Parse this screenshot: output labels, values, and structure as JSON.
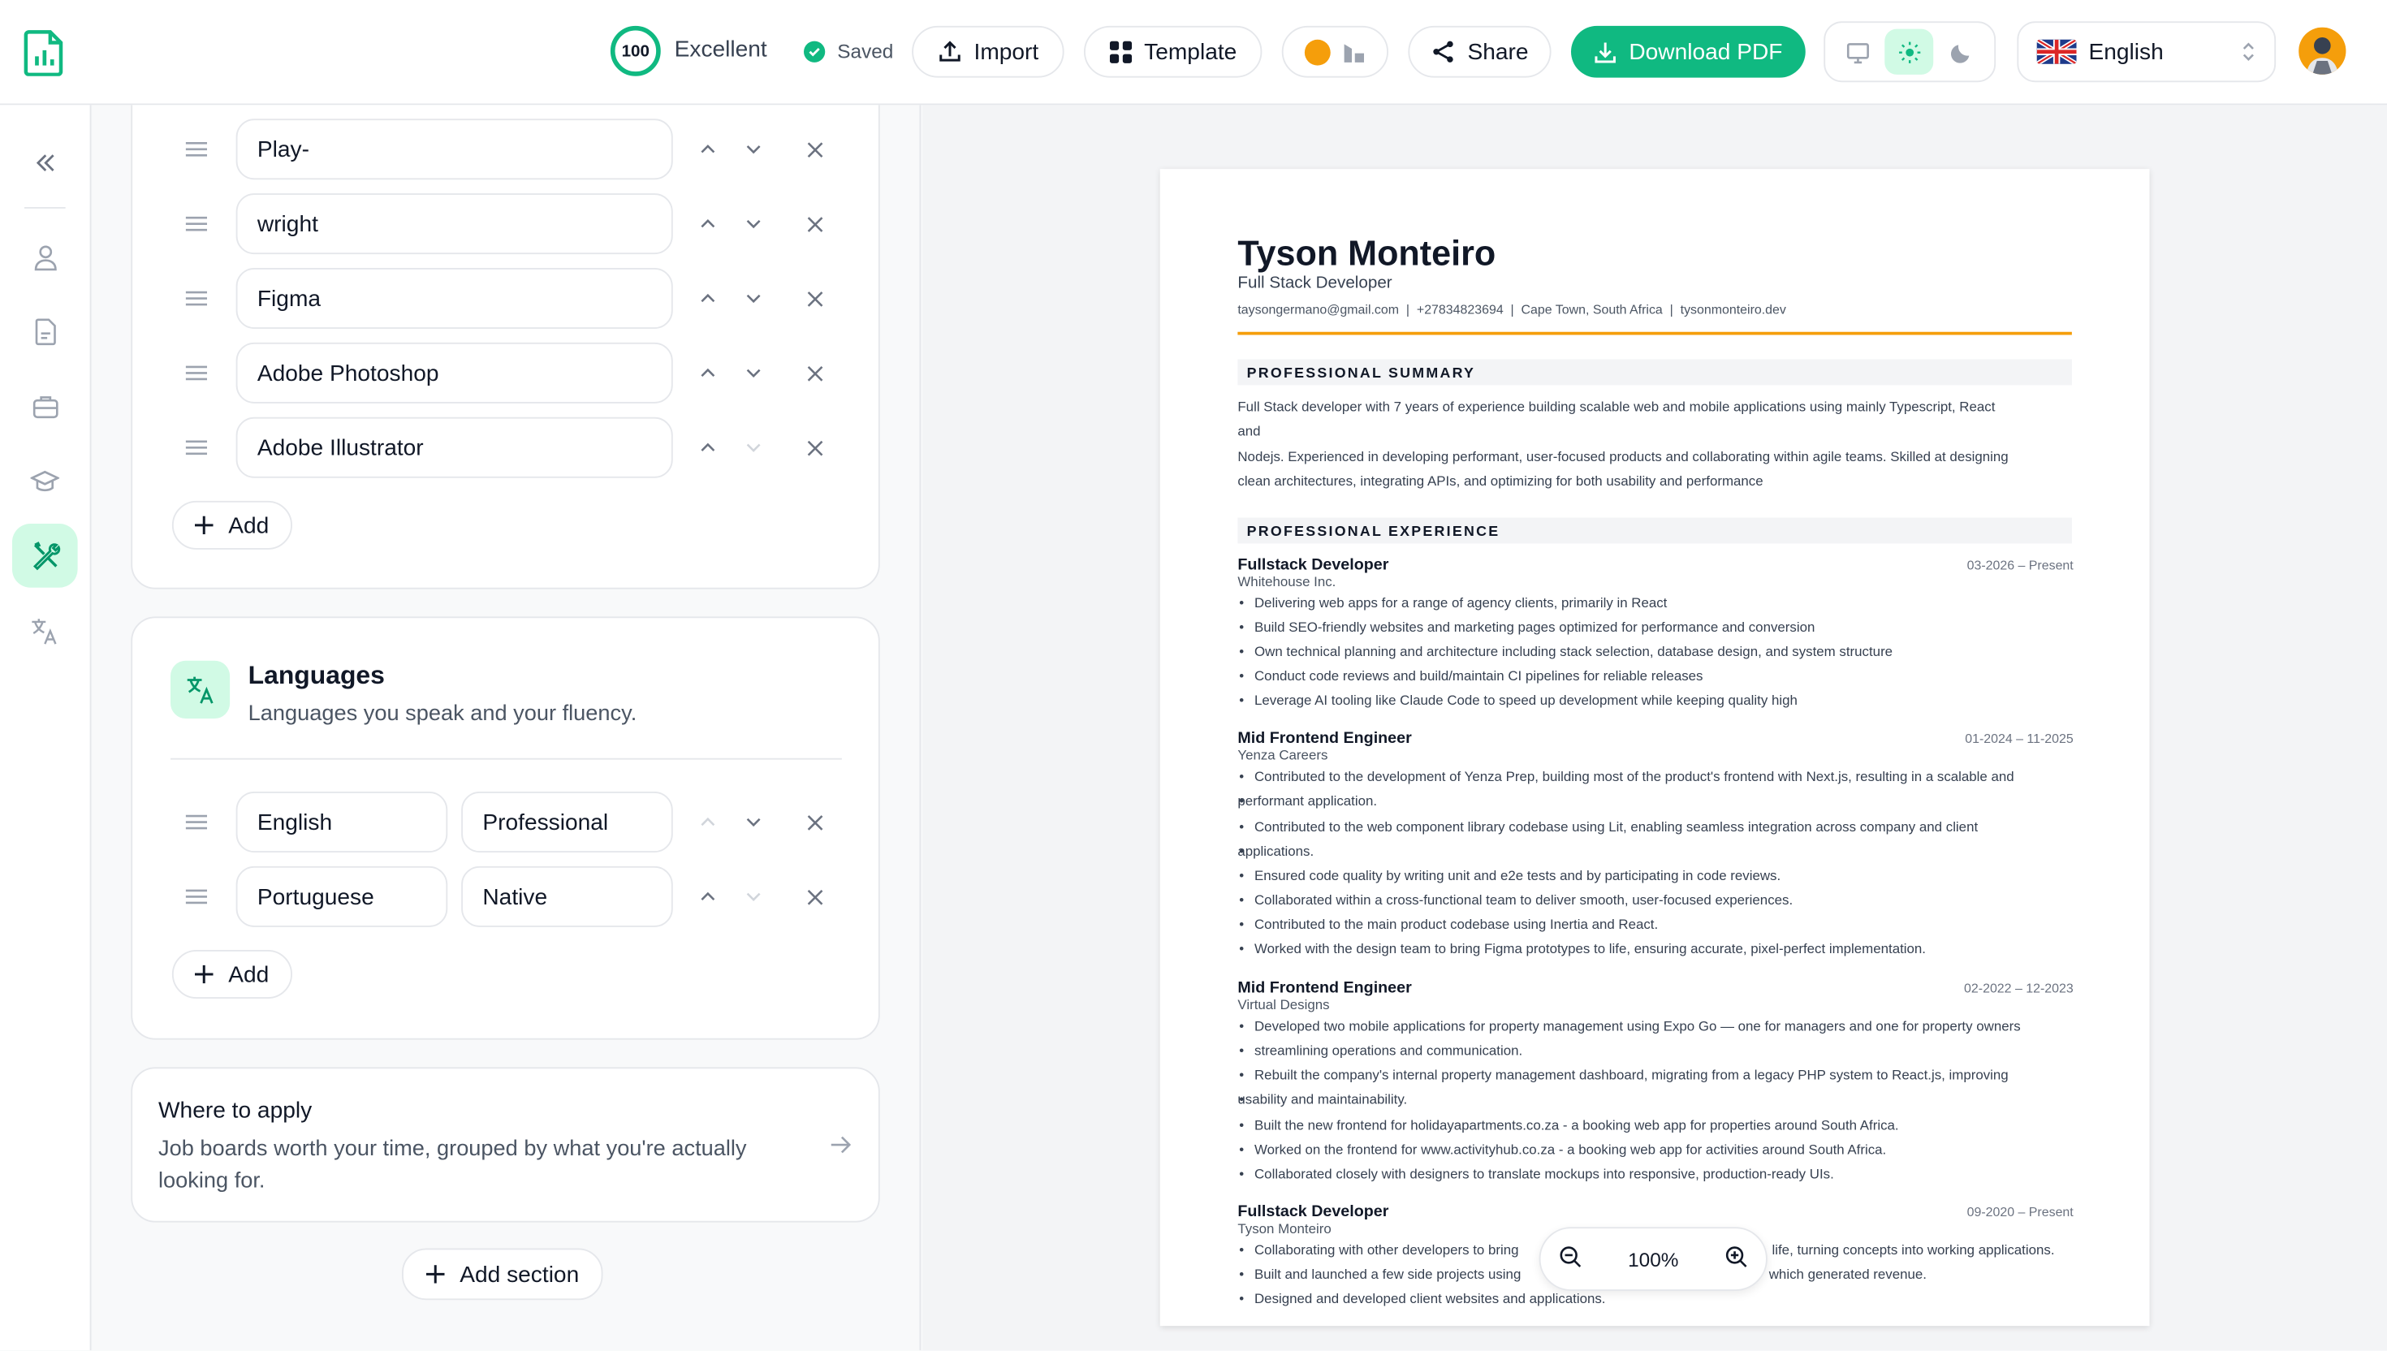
{
  "topbar": {
    "score": "100",
    "score_label": "Excellent",
    "saved_label": "Saved",
    "import_label": "Import",
    "template_label": "Template",
    "share_label": "Share",
    "download_label": "Download PDF",
    "language": "English",
    "accent_color": "#10b981"
  },
  "sidebar": {
    "items": [
      {
        "icon": "collapse-icon"
      },
      {
        "icon": "user-icon"
      },
      {
        "icon": "document-icon"
      },
      {
        "icon": "briefcase-icon"
      },
      {
        "icon": "graduation-cap-icon"
      },
      {
        "icon": "tools-icon",
        "active": true
      },
      {
        "icon": "translate-icon"
      }
    ]
  },
  "skills": {
    "items": [
      "Play-",
      "wright",
      "Figma",
      "Adobe Photoshop",
      "Adobe Illustrator"
    ],
    "add_label": "Add"
  },
  "languages": {
    "title": "Languages",
    "description": "Languages you speak and your fluency.",
    "items": [
      {
        "language": "English",
        "level": "Professional"
      },
      {
        "language": "Portuguese",
        "level": "Native"
      }
    ],
    "add_label": "Add"
  },
  "where_to_apply": {
    "title": "Where to apply",
    "line1": "Job boards worth your time, grouped by what you're actually",
    "line2": "looking for."
  },
  "add_section_label": "Add section",
  "resume": {
    "name": "Tyson Monteiro",
    "role": "Full Stack Developer",
    "contact": "taysongermano@gmail.com  |  +27834823694  |  Cape Town, South Africa  |  tysonmonteiro.dev",
    "summary_heading": "PROFESSIONAL SUMMARY",
    "summary_line1": "Full Stack developer with 7 years of experience building scalable web and mobile applications using mainly Typescript, React",
    "summary_line2": "and",
    "summary_line3": "Nodejs. Experienced in developing performant, user-focused products and collaborating within agile teams. Skilled at designing",
    "summary_line4": "clean architectures, integrating APIs, and optimizing for both usability and performance",
    "experience_heading": "PROFESSIONAL EXPERIENCE",
    "jobs": [
      {
        "title": "Fullstack Developer",
        "company": "Whitehouse Inc.",
        "dates": "03-2026 – Present",
        "bullets": [
          "Delivering web apps for a range of agency clients, primarily in React",
          "Build SEO-friendly websites and marketing pages optimized for performance and conversion",
          "Own technical planning and architecture including stack selection, database design, and system structure",
          "Conduct code reviews and build/maintain CI pipelines for reliable releases",
          "Leverage AI tooling like Claude Code to speed up development while keeping quality high"
        ]
      },
      {
        "title": "Mid Frontend Engineer",
        "company": "Yenza Careers",
        "dates": "01-2024 – 11-2025",
        "bullets": [
          "Contributed to the development of Yenza Prep, building most of the product's frontend with Next.js, resulting in a scalable and",
          "performant application.",
          "Contributed to the web component library codebase using Lit, enabling seamless integration across company and client",
          "applications.",
          "Ensured code quality by writing unit and e2e tests and by participating in code reviews.",
          "Collaborated within a cross-functional team to deliver smooth, user-focused experiences.",
          "Contributed to the main product codebase using Inertia and React.",
          "Worked with the design team to bring Figma prototypes to life, ensuring accurate, pixel-perfect implementation."
        ]
      },
      {
        "title": "Mid Frontend Engineer",
        "company": "Virtual Designs",
        "dates": "02-2022 – 12-2023",
        "bullets": [
          "Developed two mobile applications for property management using Expo Go — one for managers and one for property owners",
          "streamlining operations and communication.",
          "Rebuilt the company's internal property management dashboard, migrating from a legacy PHP system to React.js, improving",
          "usability and maintainability.",
          "Built the new frontend for holidayapartments.co.za - a booking web app for properties around South Africa.",
          "Worked on the frontend for www.activityhub.co.za - a booking web app for activities around South Africa.",
          "Collaborated closely with designers to translate mockups into responsive, production-ready UIs."
        ]
      },
      {
        "title": "Fullstack Developer",
        "company": "Tyson Monteiro",
        "dates": "09-2020 – Present",
        "bullets": [
          "Collaborating with other developers to bring",
          "life, turning concepts into working applications.",
          "Built and launched a few side projects using",
          "which generated revenue.",
          "Designed and developed client websites and applications."
        ]
      }
    ]
  },
  "zoom": {
    "level": "100%"
  }
}
